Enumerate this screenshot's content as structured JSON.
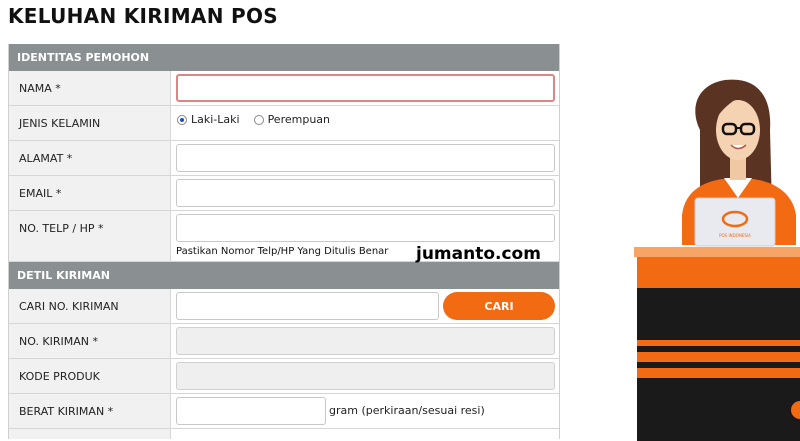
{
  "page": {
    "title": "KELUHAN KIRIMAN POS"
  },
  "sections": {
    "identity": {
      "header": "IDENTITAS PEMOHON"
    },
    "shipment": {
      "header": "DETIL KIRIMAN"
    }
  },
  "fields": {
    "nama": {
      "label": "NAMA *",
      "value": ""
    },
    "gender": {
      "label": "JENIS KELAMIN",
      "options": [
        "Laki-Laki",
        "Perempuan"
      ],
      "selected": "Laki-Laki"
    },
    "alamat": {
      "label": "ALAMAT *",
      "value": ""
    },
    "email": {
      "label": "EMAIL *",
      "value": ""
    },
    "telp": {
      "label": "NO. TELP / HP *",
      "value": "",
      "hint": "Pastikan Nomor Telp/HP Yang Ditulis Benar"
    },
    "cari": {
      "label": "CARI NO. KIRIMAN",
      "value": "",
      "button": "CARI"
    },
    "no_kiriman": {
      "label": "NO. KIRIMAN *",
      "value": ""
    },
    "kode_produk": {
      "label": "KODE PRODUK",
      "value": ""
    },
    "berat": {
      "label": "BERAT KIRIMAN *",
      "value": "",
      "unit": "gram (perkiraan/sesuai resi)"
    }
  },
  "watermark": "jumanto.com",
  "colors": {
    "accent": "#f26a12",
    "header_bg": "#8a8f92",
    "error_border": "#e08585",
    "counter_dark": "#1a1a1a"
  },
  "illustration": {
    "laptop_logo": "POS INDONESIA",
    "subject": "customer-service-agent"
  }
}
